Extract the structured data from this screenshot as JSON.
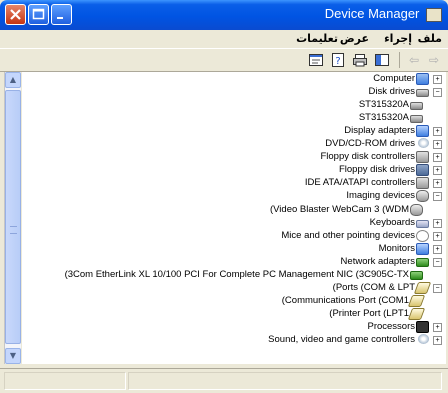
{
  "window": {
    "title": "Device Manager"
  },
  "menu": {
    "items": [
      "ملف",
      "إجراء",
      "عرض",
      "تعليمات"
    ]
  },
  "tree": {
    "nodes": [
      {
        "label": "Computer",
        "icon": "computer-icon",
        "expander": "+"
      },
      {
        "label": "Disk drives",
        "icon": "disk-icon",
        "expander": "−"
      },
      {
        "label": "ST315320A",
        "icon": "disk-icon",
        "expander": ""
      },
      {
        "label": "ST315320A",
        "icon": "disk-icon",
        "expander": ""
      },
      {
        "label": "Display adapters",
        "icon": "display-icon",
        "expander": "+"
      },
      {
        "label": "DVD/CD-ROM drives",
        "icon": "cdrom-icon",
        "expander": "+"
      },
      {
        "label": "Floppy disk controllers",
        "icon": "controller-icon",
        "expander": "+"
      },
      {
        "label": "Floppy disk drives",
        "icon": "floppy-icon",
        "expander": "+"
      },
      {
        "label": "IDE ATA/ATAPI controllers",
        "icon": "controller-icon",
        "expander": "+"
      },
      {
        "label": "Imaging devices",
        "icon": "camera-icon",
        "expander": "−"
      },
      {
        "label": "(Video Blaster WebCam 3 (WDM",
        "icon": "camera-icon",
        "expander": ""
      },
      {
        "label": "Keyboards",
        "icon": "keyboard-icon",
        "expander": "+"
      },
      {
        "label": "Mice and other pointing devices",
        "icon": "mouse-icon",
        "expander": "+"
      },
      {
        "label": "Monitors",
        "icon": "monitor-icon",
        "expander": "+"
      },
      {
        "label": "Network adapters",
        "icon": "network-icon",
        "expander": "−"
      },
      {
        "label": "(3Com EtherLink XL 10/100 PCI For Complete PC Management NIC (3C905C-TX",
        "icon": "network-icon",
        "expander": ""
      },
      {
        "label": "(Ports (COM & LPT",
        "icon": "port-icon",
        "expander": "−"
      },
      {
        "label": "(Communications Port (COM1",
        "icon": "port-icon",
        "expander": ""
      },
      {
        "label": "(Printer Port (LPT1",
        "icon": "port-icon",
        "expander": ""
      },
      {
        "label": "Processors",
        "icon": "processor-icon",
        "expander": "+"
      },
      {
        "label": "Sound, video and game controllers",
        "icon": "sound-icon",
        "expander": "+"
      }
    ]
  },
  "colors": {
    "titlebar": "#0054e3",
    "selection": "#316ac5"
  }
}
